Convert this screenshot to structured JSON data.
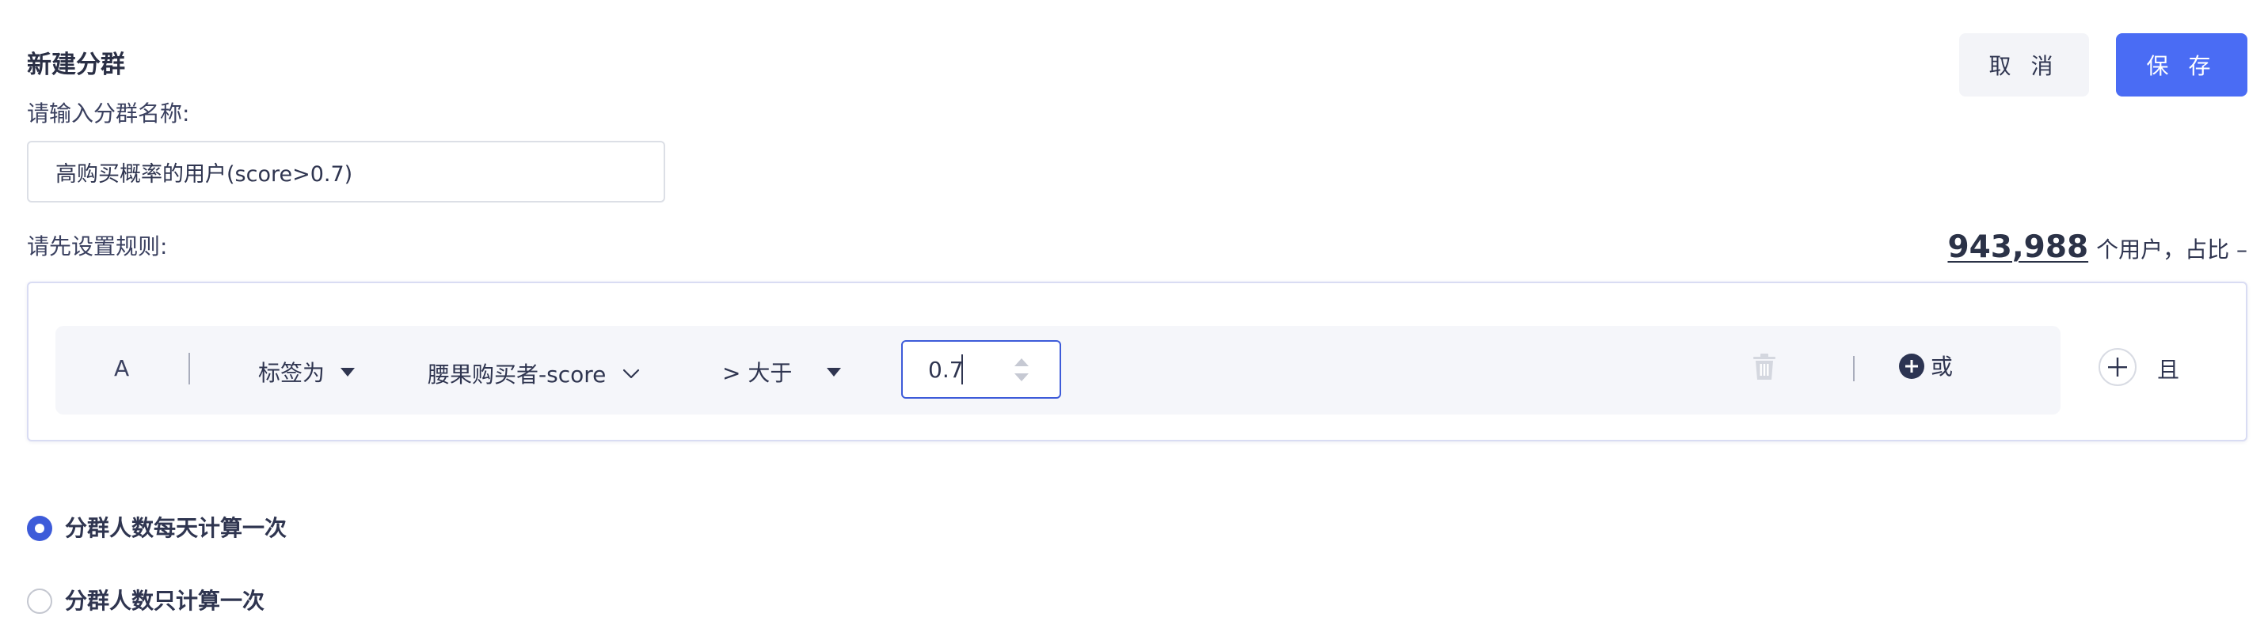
{
  "header": {
    "title": "新建分群",
    "cancel_label": "取 消",
    "save_label": "保 存"
  },
  "name_field": {
    "label": "请输入分群名称:",
    "value": "高购买概率的用户(score>0.7)"
  },
  "rules": {
    "label": "请先设置规则:",
    "user_count": "943,988",
    "user_count_suffix": "个用户，占比 –",
    "row": {
      "letter": "A",
      "type_label": "标签为",
      "tag_label": "腰果购买者-score",
      "operator_label": "> 大于",
      "value": "0.7",
      "or_label": "或"
    },
    "and_label": "且"
  },
  "schedule": {
    "options": [
      {
        "label": "分群人数每天计算一次",
        "selected": true
      },
      {
        "label": "分群人数只计算一次",
        "selected": false
      }
    ]
  },
  "colors": {
    "primary": "#4a6cf4",
    "primary_dark": "#3d5bd9",
    "text": "#2f3550",
    "row_bg": "#f5f6fa"
  }
}
